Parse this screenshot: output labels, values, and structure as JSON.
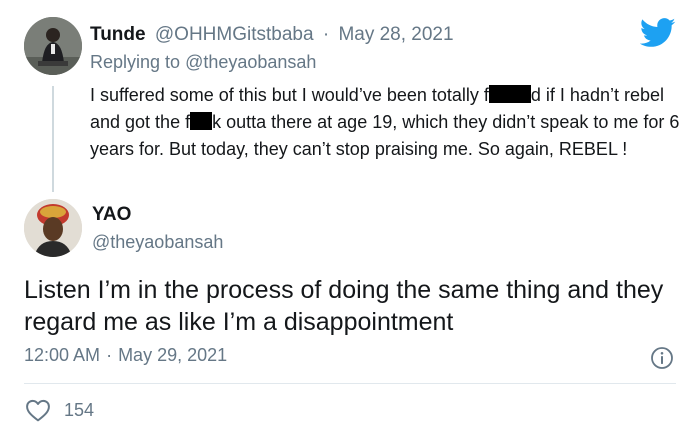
{
  "parent_tweet": {
    "display_name": "Tunde",
    "handle": "@OHHMGitstbaba",
    "separator": "·",
    "date": "May 28, 2021",
    "replying_label": "Replying to ",
    "replying_to": "@theyaobansah",
    "text_part1": "I suffered some of this but I would’ve been totally f",
    "text_part2": "d if I hadn’t rebel and got the f",
    "text_part3": "k outta there at age 19, which they didn’t speak to me for 6 years for. But today, they can’t stop praising me. So again, REBEL !"
  },
  "main_tweet": {
    "display_name": "YAO",
    "handle": "@theyaobansah",
    "text": "Listen I’m in the process of doing the same thing and they regard me as like I’m a disappointment",
    "time": "12:00 AM",
    "separator": "·",
    "date": "May 29, 2021",
    "like_count": "154"
  },
  "icons": {
    "brand": "twitter-bird-icon",
    "info": "info-icon",
    "like": "heart-icon"
  },
  "colors": {
    "brand": "#1da1f2",
    "text": "#14171a",
    "muted": "#657786",
    "divider": "#e1e8ed"
  }
}
